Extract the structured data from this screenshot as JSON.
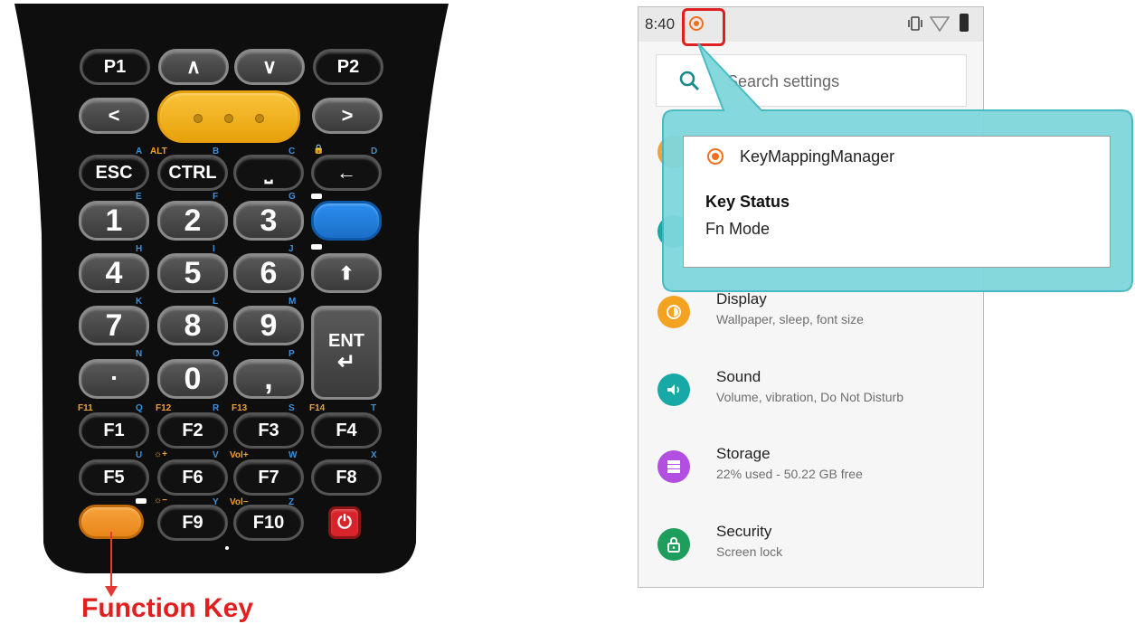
{
  "keypad": {
    "rows": [
      [
        {
          "id": "p1",
          "label": "P1"
        },
        {
          "id": "up",
          "label": "∧"
        },
        {
          "id": "down",
          "label": "∨"
        },
        {
          "id": "p2",
          "label": "P2"
        }
      ],
      [
        {
          "id": "left",
          "label": "<"
        },
        {
          "id": "right",
          "label": ">"
        }
      ],
      [
        {
          "id": "esc",
          "label": "ESC"
        },
        {
          "id": "ctrl",
          "label": "CTRL"
        },
        {
          "id": "space",
          "label": "⎵"
        },
        {
          "id": "backspace",
          "label": "←"
        }
      ],
      [
        {
          "id": "1",
          "label": "1"
        },
        {
          "id": "2",
          "label": "2"
        },
        {
          "id": "3",
          "label": "3"
        }
      ],
      [
        {
          "id": "4",
          "label": "4"
        },
        {
          "id": "5",
          "label": "5"
        },
        {
          "id": "6",
          "label": "6"
        },
        {
          "id": "shift",
          "label": "⬆"
        }
      ],
      [
        {
          "id": "7",
          "label": "7"
        },
        {
          "id": "8",
          "label": "8"
        },
        {
          "id": "9",
          "label": "9"
        },
        {
          "id": "ent",
          "label": "ENT ↵"
        }
      ],
      [
        {
          "id": "dot",
          "label": "▪"
        },
        {
          "id": "0",
          "label": "0"
        },
        {
          "id": "comma",
          "label": ","
        }
      ],
      [
        {
          "id": "f1",
          "label": "F1"
        },
        {
          "id": "f2",
          "label": "F2"
        },
        {
          "id": "f3",
          "label": "F3"
        },
        {
          "id": "f4",
          "label": "F4"
        }
      ],
      [
        {
          "id": "f5",
          "label": "F5"
        },
        {
          "id": "f6",
          "label": "F6"
        },
        {
          "id": "f7",
          "label": "F7"
        },
        {
          "id": "f8",
          "label": "F8"
        }
      ],
      [
        {
          "id": "f9",
          "label": "F9"
        },
        {
          "id": "f10",
          "label": "F10"
        }
      ]
    ],
    "letters": [
      "A",
      "B",
      "C",
      "D",
      "E",
      "F",
      "G",
      "H",
      "I",
      "J",
      "K",
      "L",
      "M",
      "N",
      "O",
      "P",
      "Q",
      "R",
      "S",
      "T",
      "U",
      "V",
      "W",
      "X",
      "Y",
      "Z"
    ],
    "alt_labels": {
      "alt": "ALT",
      "f11": "F11",
      "f12": "F12",
      "f13": "F13",
      "f14": "F14",
      "bright_up": "☼+",
      "vol_up": "Vol+",
      "bright_down": "☼−",
      "vol_down": "Vol−"
    },
    "ent_label": "ENT",
    "function_key_caption": "Function Key",
    "colors": {
      "scan": "#F0B020",
      "blue_key": "#2080E0",
      "function_key": "#F0962A",
      "power": "#D8232A",
      "caption": "#E02020"
    }
  },
  "phone": {
    "status_bar": {
      "time": "8:40"
    },
    "search": {
      "placeholder": "Search settings"
    },
    "settings": [
      {
        "title": "Display",
        "subtitle": "Wallpaper, sleep, font size",
        "icon": "display-icon",
        "color": "#F4A321"
      },
      {
        "title": "Sound",
        "subtitle": "Volume, vibration, Do Not Disturb",
        "icon": "sound-icon",
        "color": "#17A9A5"
      },
      {
        "title": "Storage",
        "subtitle": "22% used - 50.22 GB free",
        "icon": "storage-icon",
        "color": "#B24FE0"
      },
      {
        "title": "Security",
        "subtitle": "Screen lock",
        "icon": "lock-icon",
        "color": "#1E9E5C"
      }
    ],
    "notification": {
      "app_name": "KeyMappingManager",
      "title": "Key Status",
      "text": "Fn Mode"
    }
  }
}
